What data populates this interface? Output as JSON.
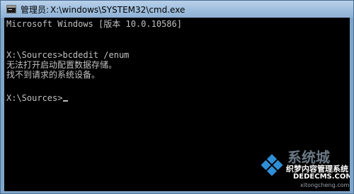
{
  "window": {
    "title_user": "管理员:",
    "title_path": "X:\\windows\\SYSTEM32\\cmd.exe"
  },
  "console": {
    "lines": [
      "Microsoft Windows [版本 10.0.10586]",
      "",
      "X:\\Sources>bcdedit /enum",
      "无法打开启动配置数据存储。",
      "找不到请求的系统设备。",
      "",
      "X:\\Sources>"
    ]
  },
  "watermark": {
    "site_name": "系统城",
    "text_line1": "织梦内容管理系统",
    "text_line2": "DEDECMS.COM",
    "text_line3": "xitongcheng.com"
  },
  "colors": {
    "console_bg": "#000000",
    "console_text": "#c0c0c0",
    "titlebar": "#9cbcdc"
  }
}
